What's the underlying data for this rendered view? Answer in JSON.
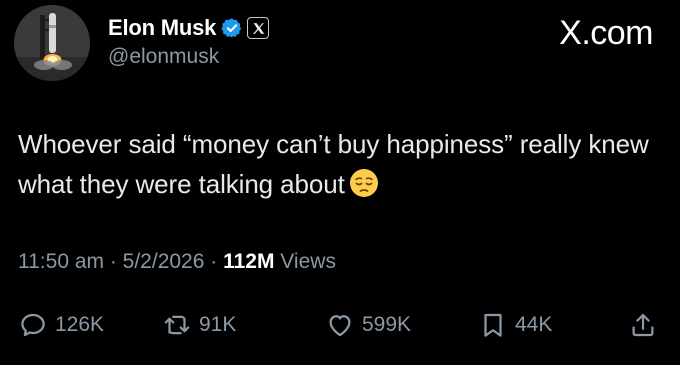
{
  "header": {
    "display_name": "Elon Musk",
    "handle": "@elonmusk",
    "brand": "X.com",
    "verified_color": "#1d9bf0",
    "avatar_icon": "rocket-launch-avatar",
    "affiliation_icon": "x-logo-icon"
  },
  "tweet": {
    "text": "Whoever said “money can’t buy happiness” really knew what they were talking about",
    "emoji": "pensive-face"
  },
  "meta": {
    "time": "11:50 am",
    "separator1": " · ",
    "date": "5/2/2026",
    "separator2": " · ",
    "views_count": "112M",
    "views_label": " Views"
  },
  "actions": {
    "replies": "126K",
    "reposts": "91K",
    "likes": "599K",
    "bookmarks": "44K",
    "icons": [
      "reply-icon",
      "repost-icon",
      "like-icon",
      "bookmark-icon",
      "share-icon"
    ]
  }
}
